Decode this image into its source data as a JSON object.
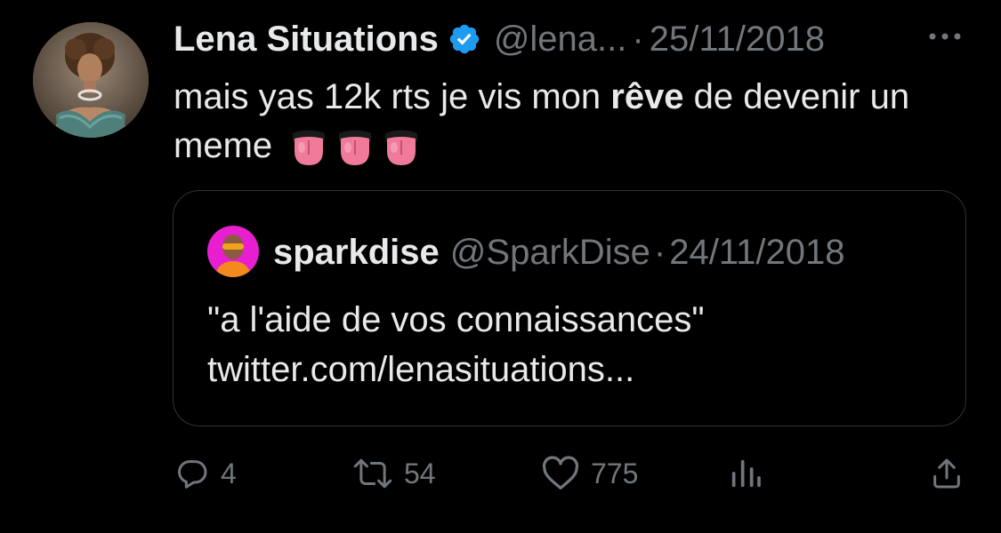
{
  "tweet": {
    "author": {
      "display_name": "Lena Situations",
      "handle": "@lena...",
      "verified": true
    },
    "date": "25/11/2018",
    "separator": "·",
    "text": {
      "part1": "mais yas 12k rts je vis mon ",
      "bold": "rêve",
      "part2": " de devenir un meme",
      "emojis": [
        "tongue-emoji",
        "tongue-emoji",
        "tongue-emoji"
      ]
    },
    "quoted": {
      "display_name": "sparkdise",
      "handle": "@SparkDise",
      "date": "24/11/2018",
      "text": "\"a l'aide de vos connaissances\" twitter.com/lenasituations..."
    },
    "actions": {
      "replies": "4",
      "retweets": "54",
      "likes": "775"
    }
  },
  "colors": {
    "background": "#000000",
    "text": "#e7e9ea",
    "muted": "#71767b",
    "verified": "#1d9bf0",
    "border": "#2f3336",
    "quoted_avatar_bg": "#e81fd0"
  },
  "icons": [
    "verified-badge-icon",
    "more-options-icon",
    "reply-icon",
    "retweet-icon",
    "like-icon",
    "views-icon",
    "share-icon"
  ]
}
